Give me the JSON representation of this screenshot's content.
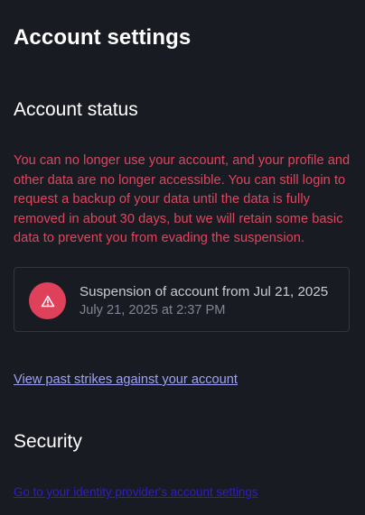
{
  "header": {
    "title": "Account settings"
  },
  "account_status": {
    "section_title": "Account status",
    "warning": "You can no longer use your account, and your profile and other data are no longer accessible. You can still login to request a backup of your data until the data is fully removed in about 30 days, but we will retain some basic data to prevent you from evading the suspension.",
    "strike": {
      "icon": "warning-triangle-icon",
      "title": "Suspension of account from Jul 21, 2025",
      "date": "July 21, 2025 at 2:37 PM"
    },
    "past_strikes_link": "View past strikes against your account"
  },
  "security": {
    "section_title": "Security",
    "identity_provider_link": "Go to your identity provider's account settings"
  },
  "colors": {
    "background": "#191b22",
    "danger": "#e0455e",
    "link": "#9ea3f5"
  }
}
